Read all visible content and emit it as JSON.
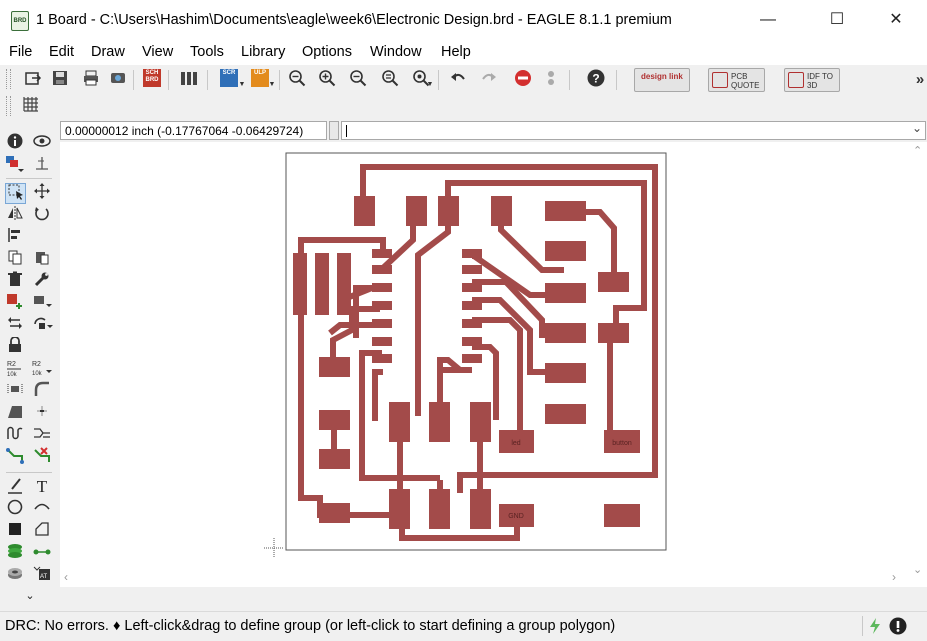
{
  "window": {
    "title": "1 Board - C:\\Users\\Hashim\\Documents\\eagle\\week6\\Electronic Design.brd - EAGLE 8.1.1 premium",
    "app_icon_text": "BRD",
    "minimize": "—",
    "maximize": "☐",
    "close": "✕"
  },
  "menu": [
    "File",
    "Edit",
    "Draw",
    "View",
    "Tools",
    "Library",
    "Options",
    "Window",
    "Help"
  ],
  "toolbar": {
    "sch_chip": "SCH BRD",
    "scr_chip": "SCR",
    "ulp_chip": "ULP",
    "design_link": "design link",
    "pcb_quote": "PCB QUOTE",
    "idf_to_3d": "IDF TO 3D",
    "overflow": "»"
  },
  "coordinates": "0.00000012 inch (-0.17767064 -0.06429724)",
  "command_value": "",
  "board_labels": {
    "led": "led",
    "button": "button",
    "gnd": "GND"
  },
  "status": {
    "text": "DRC: No errors.  ♦ Left-click&drag to define group (or left-click to start defining a group polygon)"
  },
  "colors": {
    "copper": "#a34b4a",
    "stop_red": "#d32f2f",
    "drc_ok_green": "#5cb85c"
  }
}
